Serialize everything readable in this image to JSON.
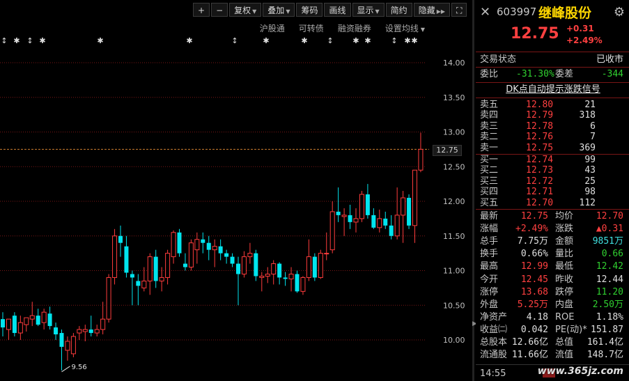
{
  "toolbar": {
    "buttons": [
      "+",
      "−",
      "复权",
      "叠加",
      "筹码",
      "画线",
      "显示",
      "简约",
      "隐藏"
    ],
    "expand_label": "⛶"
  },
  "subbar": [
    "沪股通",
    "可转债",
    "融资融券",
    "设置均线"
  ],
  "chart_data": {
    "type": "candlestick",
    "y_ticks": [
      "14.00",
      "13.50",
      "13.00",
      "12.50",
      "12.00",
      "11.50",
      "11.00",
      "10.50",
      "10.00"
    ],
    "ylim": [
      9.45,
      14.45
    ],
    "last_price_label": "12.75",
    "last_price": 12.75,
    "low_label": "9.56",
    "low_value": 9.56,
    "candles": [
      {
        "o": 10.3,
        "h": 10.4,
        "l": 10.05,
        "c": 10.18
      },
      {
        "o": 10.15,
        "h": 10.28,
        "l": 10.0,
        "c": 10.3
      },
      {
        "o": 10.35,
        "h": 10.4,
        "l": 10.05,
        "c": 10.1
      },
      {
        "o": 10.1,
        "h": 10.35,
        "l": 10.0,
        "c": 10.25
      },
      {
        "o": 10.22,
        "h": 10.3,
        "l": 10.12,
        "c": 10.32
      },
      {
        "o": 10.3,
        "h": 10.55,
        "l": 10.2,
        "c": 10.35
      },
      {
        "o": 10.35,
        "h": 10.45,
        "l": 10.2,
        "c": 10.22
      },
      {
        "o": 10.25,
        "h": 10.45,
        "l": 10.15,
        "c": 10.4
      },
      {
        "o": 10.38,
        "h": 10.48,
        "l": 10.15,
        "c": 10.2
      },
      {
        "o": 10.18,
        "h": 10.25,
        "l": 10.0,
        "c": 10.08
      },
      {
        "o": 10.1,
        "h": 10.15,
        "l": 9.56,
        "c": 9.9
      },
      {
        "o": 9.85,
        "h": 10.05,
        "l": 9.7,
        "c": 9.98
      },
      {
        "o": 9.8,
        "h": 10.1,
        "l": 9.75,
        "c": 10.05
      },
      {
        "o": 10.1,
        "h": 10.2,
        "l": 10.0,
        "c": 10.15
      },
      {
        "o": 10.12,
        "h": 10.22,
        "l": 9.98,
        "c": 10.15
      },
      {
        "o": 10.15,
        "h": 10.35,
        "l": 10.05,
        "c": 10.1
      },
      {
        "o": 10.1,
        "h": 10.22,
        "l": 10.05,
        "c": 10.15
      },
      {
        "o": 10.15,
        "h": 10.55,
        "l": 10.08,
        "c": 10.3
      },
      {
        "o": 10.3,
        "h": 10.95,
        "l": 10.25,
        "c": 10.9
      },
      {
        "o": 10.9,
        "h": 11.6,
        "l": 10.8,
        "c": 11.5
      },
      {
        "o": 11.5,
        "h": 11.65,
        "l": 11.2,
        "c": 11.4
      },
      {
        "o": 11.35,
        "h": 11.5,
        "l": 10.9,
        "c": 10.97
      },
      {
        "o": 10.95,
        "h": 11.0,
        "l": 10.5,
        "c": 10.9
      },
      {
        "o": 10.85,
        "h": 10.95,
        "l": 10.5,
        "c": 10.78
      },
      {
        "o": 10.75,
        "h": 11.05,
        "l": 10.7,
        "c": 10.85
      },
      {
        "o": 10.85,
        "h": 11.25,
        "l": 10.65,
        "c": 11.2
      },
      {
        "o": 11.2,
        "h": 11.3,
        "l": 10.75,
        "c": 10.85
      },
      {
        "o": 10.85,
        "h": 11.05,
        "l": 10.7,
        "c": 10.9
      },
      {
        "o": 10.9,
        "h": 11.3,
        "l": 10.8,
        "c": 11.25
      },
      {
        "o": 11.2,
        "h": 11.58,
        "l": 11.1,
        "c": 11.55
      },
      {
        "o": 11.55,
        "h": 11.6,
        "l": 11.2,
        "c": 11.25
      },
      {
        "o": 11.1,
        "h": 11.25,
        "l": 11.0,
        "c": 11.05
      },
      {
        "o": 11.05,
        "h": 11.45,
        "l": 11.0,
        "c": 11.4
      },
      {
        "o": 11.3,
        "h": 11.55,
        "l": 11.1,
        "c": 11.45
      },
      {
        "o": 11.45,
        "h": 11.55,
        "l": 11.25,
        "c": 11.4
      },
      {
        "o": 11.4,
        "h": 11.5,
        "l": 11.15,
        "c": 11.3
      },
      {
        "o": 11.3,
        "h": 11.45,
        "l": 11.05,
        "c": 11.35
      },
      {
        "o": 11.35,
        "h": 11.45,
        "l": 11.15,
        "c": 11.25
      },
      {
        "o": 11.25,
        "h": 11.3,
        "l": 11.1,
        "c": 11.2
      },
      {
        "o": 11.2,
        "h": 11.25,
        "l": 11.05,
        "c": 11.1
      },
      {
        "o": 11.1,
        "h": 11.2,
        "l": 10.5,
        "c": 10.95
      },
      {
        "o": 10.95,
        "h": 11.28,
        "l": 10.9,
        "c": 11.2
      },
      {
        "o": 11.2,
        "h": 11.4,
        "l": 11.1,
        "c": 11.25
      },
      {
        "o": 11.25,
        "h": 11.3,
        "l": 10.85,
        "c": 10.92
      },
      {
        "o": 10.9,
        "h": 10.98,
        "l": 10.7,
        "c": 10.92
      },
      {
        "o": 10.92,
        "h": 11.05,
        "l": 10.82,
        "c": 10.95
      },
      {
        "o": 10.95,
        "h": 11.15,
        "l": 10.8,
        "c": 11.1
      },
      {
        "o": 11.1,
        "h": 11.12,
        "l": 10.8,
        "c": 10.9
      },
      {
        "o": 10.9,
        "h": 10.98,
        "l": 10.78,
        "c": 10.88
      },
      {
        "o": 10.88,
        "h": 11.05,
        "l": 10.7,
        "c": 10.95
      },
      {
        "o": 10.95,
        "h": 11.0,
        "l": 10.68,
        "c": 10.7
      },
      {
        "o": 10.7,
        "h": 10.92,
        "l": 10.65,
        "c": 10.9
      },
      {
        "o": 10.9,
        "h": 11.45,
        "l": 10.85,
        "c": 11.2
      },
      {
        "o": 11.2,
        "h": 11.25,
        "l": 10.85,
        "c": 10.9
      },
      {
        "o": 10.9,
        "h": 11.3,
        "l": 10.88,
        "c": 11.25
      },
      {
        "o": 11.25,
        "h": 11.55,
        "l": 11.15,
        "c": 11.25
      },
      {
        "o": 11.3,
        "h": 12.0,
        "l": 11.25,
        "c": 11.85
      },
      {
        "o": 11.85,
        "h": 12.2,
        "l": 11.7,
        "c": 11.8
      },
      {
        "o": 11.78,
        "h": 11.9,
        "l": 11.5,
        "c": 11.8
      },
      {
        "o": 11.8,
        "h": 11.95,
        "l": 11.6,
        "c": 11.7
      },
      {
        "o": 11.7,
        "h": 11.9,
        "l": 11.55,
        "c": 11.75
      },
      {
        "o": 11.75,
        "h": 12.15,
        "l": 11.7,
        "c": 12.1
      },
      {
        "o": 12.1,
        "h": 12.25,
        "l": 11.75,
        "c": 11.8
      },
      {
        "o": 11.8,
        "h": 11.9,
        "l": 11.6,
        "c": 11.62
      },
      {
        "o": 11.62,
        "h": 11.88,
        "l": 11.55,
        "c": 11.75
      },
      {
        "o": 11.75,
        "h": 11.85,
        "l": 11.6,
        "c": 11.65
      },
      {
        "o": 11.65,
        "h": 11.8,
        "l": 11.45,
        "c": 11.5
      },
      {
        "o": 11.5,
        "h": 12.2,
        "l": 11.45,
        "c": 11.8
      },
      {
        "o": 11.8,
        "h": 12.15,
        "l": 11.4,
        "c": 12.05
      },
      {
        "o": 12.05,
        "h": 12.1,
        "l": 11.6,
        "c": 11.65
      },
      {
        "o": 11.65,
        "h": 12.45,
        "l": 11.4,
        "c": 12.45
      },
      {
        "o": 12.45,
        "h": 12.99,
        "l": 12.42,
        "c": 12.75
      }
    ]
  },
  "stock": {
    "code": "603997",
    "name": "继峰股份",
    "price": "12.75",
    "change": "+0.31",
    "change_pct": "+2.49%"
  },
  "status": {
    "label": "交易状态",
    "value": "已收市"
  },
  "wei": {
    "ratio_label": "委比",
    "ratio_value": "-31.30%",
    "diff_label": "委差",
    "diff_value": "-344"
  },
  "dk_signal": "DK点自动提示涨跌信号",
  "asks": [
    {
      "label": "卖五",
      "price": "12.80",
      "vol": "21"
    },
    {
      "label": "卖四",
      "price": "12.79",
      "vol": "318"
    },
    {
      "label": "卖三",
      "price": "12.78",
      "vol": "6"
    },
    {
      "label": "卖二",
      "price": "12.76",
      "vol": "7"
    },
    {
      "label": "卖一",
      "price": "12.75",
      "vol": "369"
    }
  ],
  "bids": [
    {
      "label": "买一",
      "price": "12.74",
      "vol": "99"
    },
    {
      "label": "买二",
      "price": "12.73",
      "vol": "43"
    },
    {
      "label": "买三",
      "price": "12.72",
      "vol": "25"
    },
    {
      "label": "买四",
      "price": "12.71",
      "vol": "98"
    },
    {
      "label": "买五",
      "price": "12.70",
      "vol": "112"
    }
  ],
  "stats": [
    {
      "l1": "最新",
      "v1": "12.75",
      "c1": "red",
      "l2": "均价",
      "v2": "12.70",
      "c2": "red"
    },
    {
      "l1": "涨幅",
      "v1": "+2.49%",
      "c1": "red",
      "l2": "涨跌",
      "v2": "▲0.31",
      "c2": "red"
    },
    {
      "l1": "总手",
      "v1": "7.75万",
      "c1": "white",
      "l2": "金额",
      "v2": "9851万",
      "c2": "cyan"
    },
    {
      "l1": "换手",
      "v1": "0.66%",
      "c1": "white",
      "l2": "量比",
      "v2": "0.66",
      "c2": "green"
    },
    {
      "l1": "最高",
      "v1": "12.99",
      "c1": "red",
      "l2": "最低",
      "v2": "12.42",
      "c2": "green"
    },
    {
      "l1": "今开",
      "v1": "12.45",
      "c1": "red",
      "l2": "昨收",
      "v2": "12.44",
      "c2": "white"
    },
    {
      "l1": "涨停",
      "v1": "13.68",
      "c1": "red",
      "l2": "跌停",
      "v2": "11.20",
      "c2": "green"
    },
    {
      "l1": "外盘",
      "v1": "5.25万",
      "c1": "red",
      "l2": "内盘",
      "v2": "2.50万",
      "c2": "green"
    },
    {
      "l1": "净资产",
      "v1": "4.18",
      "c1": "white",
      "l2": "ROE",
      "v2": "1.18%",
      "c2": "white"
    },
    {
      "l1": "收益㈡",
      "v1": "0.042",
      "c1": "white",
      "l2": "PE(动)*",
      "v2": "151.87",
      "c2": "white"
    },
    {
      "l1": "总股本",
      "v1": "12.66亿",
      "c1": "white",
      "l2": "总值",
      "v2": "161.4亿",
      "c2": "white"
    },
    {
      "l1": "流通股",
      "v1": "11.66亿",
      "c1": "white",
      "l2": "流值",
      "v2": "148.7亿",
      "c2": "white"
    }
  ],
  "footer": {
    "time": "14:55"
  },
  "watermark": "www.365jz.com",
  "colors": {
    "up": "#ff3c3c",
    "down": "#00e5ee",
    "grid": "#7a1616",
    "price_line": "#d08030"
  }
}
